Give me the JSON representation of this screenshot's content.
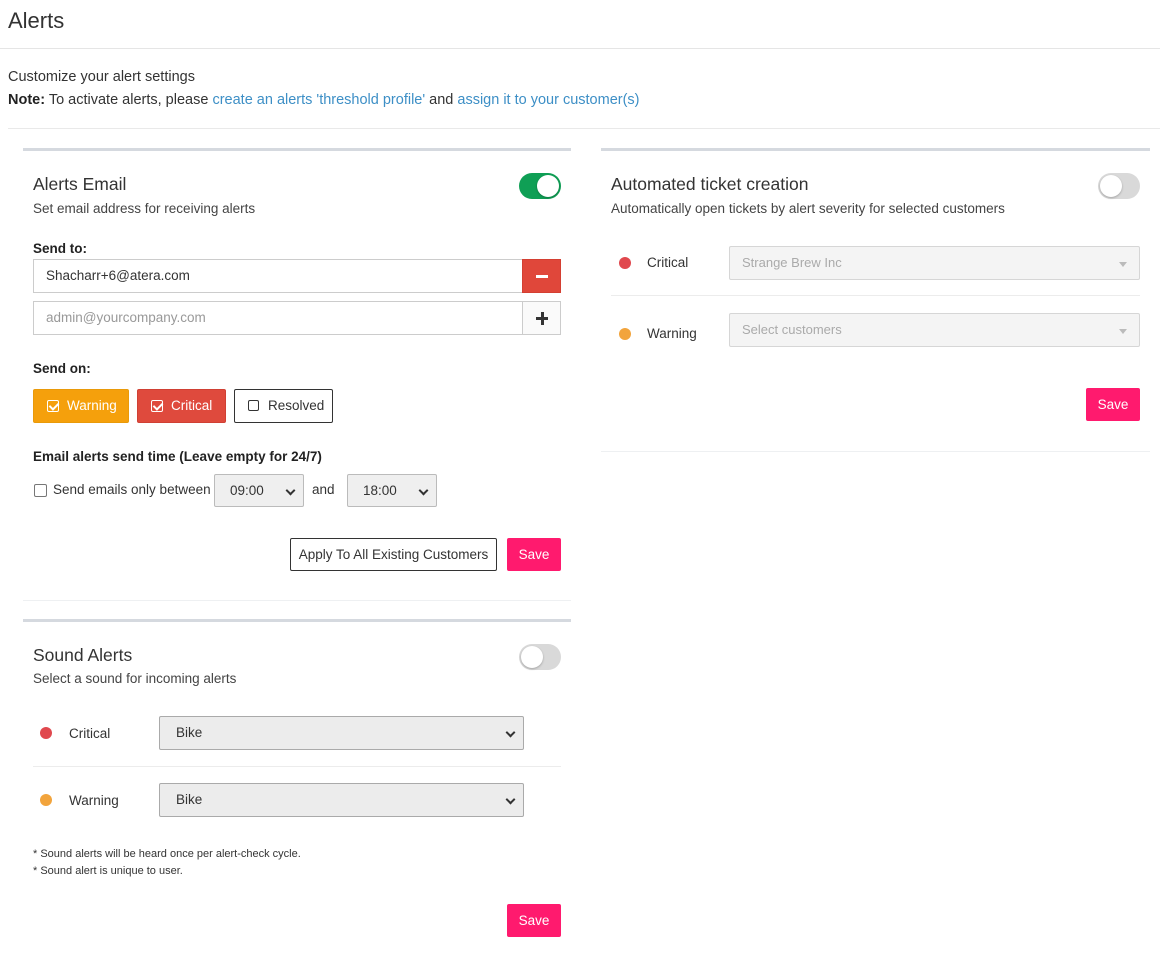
{
  "page": {
    "title": "Alerts"
  },
  "intro": {
    "line1": "Customize your alert settings",
    "note_label": "Note:",
    "note_text1": " To activate alerts, please ",
    "link1": "create an alerts 'threshold profile'",
    "note_text2": " and ",
    "link2": "assign it to your customer(s)"
  },
  "alerts_email": {
    "title": "Alerts Email",
    "subtitle": "Set email address for receiving alerts",
    "enabled": true,
    "send_to_label": "Send to:",
    "emails": [
      "Shacharr+6@atera.com"
    ],
    "new_email_placeholder": "admin@yourcompany.com",
    "send_on_label": "Send on:",
    "severities": [
      {
        "label": "Warning",
        "checked": true,
        "color": "#f5a00c"
      },
      {
        "label": "Critical",
        "checked": true,
        "color": "#df4a3d"
      },
      {
        "label": "Resolved",
        "checked": false,
        "color": "#ffffff"
      }
    ],
    "send_time_label": "Email alerts send time (Leave empty for 24/7)",
    "send_between_label": "Send emails only between",
    "send_between_checked": false,
    "start_time": "09:00",
    "and_label": "and",
    "end_time": "18:00",
    "apply_all_label": "Apply To All Existing Customers",
    "save_label": "Save"
  },
  "sound_alerts": {
    "title": "Sound Alerts",
    "subtitle": "Select a sound for incoming alerts",
    "enabled": false,
    "rows": [
      {
        "label": "Critical",
        "sound": "Bike",
        "color": "#e0484e"
      },
      {
        "label": "Warning",
        "sound": "Bike",
        "color": "#f2a43c"
      }
    ],
    "notes": [
      "* Sound alerts will be heard once per alert-check cycle.",
      "* Sound alert is unique to user."
    ],
    "save_label": "Save"
  },
  "ticket_creation": {
    "title": "Automated ticket creation",
    "subtitle": "Automatically open tickets by alert severity for selected customers",
    "enabled": false,
    "rows": [
      {
        "label": "Critical",
        "value": "Strange Brew Inc",
        "color": "#e0484e"
      },
      {
        "label": "Warning",
        "value": "Select customers",
        "color": "#f2a43c"
      }
    ],
    "save_label": "Save"
  },
  "colors": {
    "accent_save": "#ff1a6e",
    "toggle_on": "#0f9f55",
    "link": "#3d8fc6"
  }
}
